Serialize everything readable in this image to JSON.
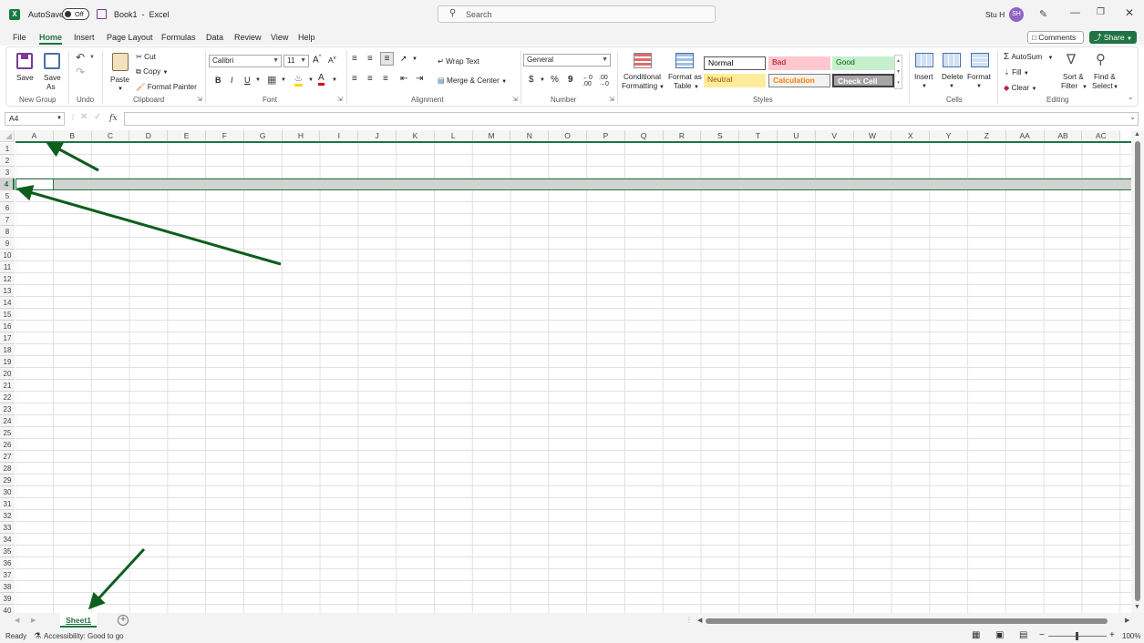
{
  "title_bar": {
    "autosave_label": "AutoSave",
    "autosave_state": "Off",
    "document_title": "Book1  -  Excel",
    "search_placeholder": "Search",
    "user_name": "Stu H",
    "user_initials": "SH"
  },
  "menu": {
    "tabs": [
      "File",
      "Home",
      "Insert",
      "Page Layout",
      "Formulas",
      "Data",
      "Review",
      "View",
      "Help"
    ],
    "active_tab": "Home",
    "comments_label": "Comments",
    "share_label": "Share"
  },
  "ribbon": {
    "new_group": {
      "save": "Save",
      "save_as_1": "Save",
      "save_as_2": "As",
      "group": "New Group"
    },
    "undo": {
      "group": "Undo"
    },
    "clipboard": {
      "paste": "Paste",
      "cut": "Cut",
      "copy": "Copy",
      "format_painter": "Format Painter",
      "group": "Clipboard"
    },
    "font": {
      "name": "Calibri",
      "size": "11",
      "bold": "B",
      "italic": "I",
      "underline": "U",
      "group": "Font"
    },
    "alignment": {
      "wrap_text": "Wrap Text",
      "merge_center": "Merge & Center",
      "group": "Alignment"
    },
    "number": {
      "format": "General",
      "currency": "$",
      "percent": "%",
      "comma": "9",
      "group": "Number"
    },
    "styles": {
      "conditional_1": "Conditional",
      "conditional_2": "Formatting",
      "format_table_1": "Format as",
      "format_table_2": "Table",
      "normal": "Normal",
      "bad": "Bad",
      "good": "Good",
      "neutral": "Neutral",
      "calculation": "Calculation",
      "check_cell": "Check Cell",
      "group": "Styles"
    },
    "cells": {
      "insert": "Insert",
      "delete": "Delete",
      "format": "Format",
      "group": "Cells"
    },
    "editing": {
      "autosum": "AutoSum",
      "fill": "Fill",
      "clear": "Clear",
      "sort_1": "Sort &",
      "sort_2": "Filter",
      "find_1": "Find &",
      "find_2": "Select",
      "group": "Editing"
    }
  },
  "formula_bar": {
    "name_box": "A4",
    "fx": "fx",
    "formula": ""
  },
  "grid": {
    "columns": [
      "A",
      "B",
      "C",
      "D",
      "E",
      "F",
      "G",
      "H",
      "I",
      "J",
      "K",
      "L",
      "M",
      "N",
      "O",
      "P",
      "Q",
      "R",
      "S",
      "T",
      "U",
      "V",
      "W",
      "X",
      "Y",
      "Z",
      "AA",
      "AB",
      "AC"
    ],
    "rows": [
      "1",
      "2",
      "3",
      "4",
      "5",
      "6",
      "7",
      "8",
      "9",
      "10",
      "11",
      "12",
      "13",
      "14",
      "15",
      "16",
      "17",
      "18",
      "19",
      "20",
      "21",
      "22",
      "23",
      "24",
      "25",
      "26",
      "27",
      "28",
      "29",
      "30",
      "31",
      "32",
      "33",
      "34",
      "35",
      "36",
      "37",
      "38",
      "39",
      "40"
    ],
    "selected_row": "4",
    "active_cell": "A4"
  },
  "sheet_tabs": {
    "active": "Sheet1"
  },
  "status": {
    "ready": "Ready",
    "accessibility": "Accessibility: Good to go",
    "zoom": "100%"
  },
  "colors": {
    "accent": "#217346",
    "arrow": "#0c5f1c",
    "bad_bg": "#ffc7ce",
    "bad_fg": "#9c0006",
    "good_bg": "#c6efce",
    "good_fg": "#006100",
    "neutral_bg": "#ffeb9c",
    "neutral_fg": "#9c5700",
    "calc_fg": "#fa7d00"
  }
}
